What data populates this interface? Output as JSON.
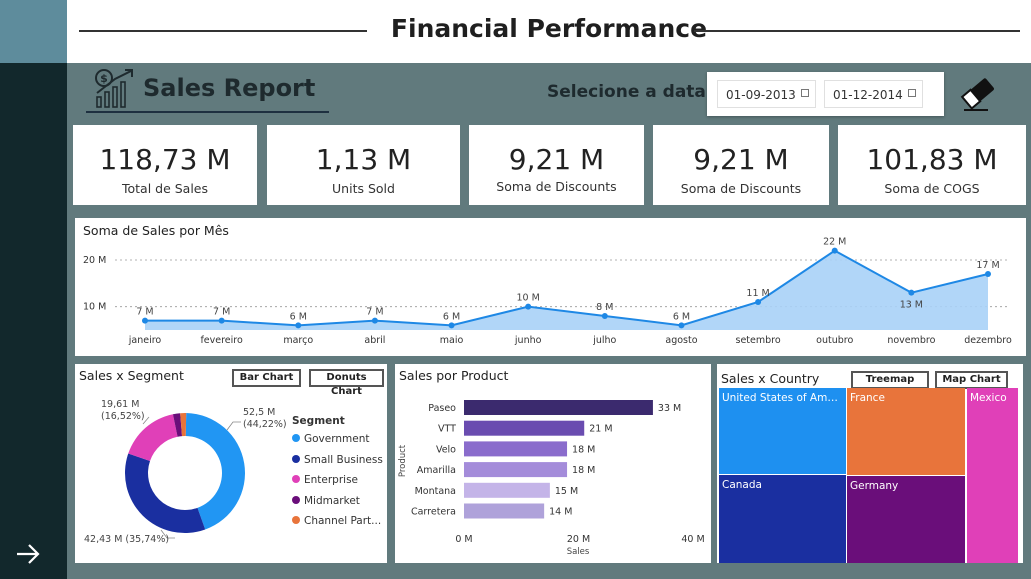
{
  "header": {
    "title": "Financial Performance"
  },
  "report": {
    "title": "Sales Report"
  },
  "date_filter": {
    "label": "Selecione a data",
    "start": "01-09-2013",
    "end": "01-12-2014"
  },
  "kpis": [
    {
      "value": "118,73 M",
      "label": "Total de  Sales"
    },
    {
      "value": "1,13 M",
      "label": "Units Sold"
    },
    {
      "value": "9,21 M",
      "label": "Soma de Discounts"
    },
    {
      "value": "9,21 M",
      "label": "Soma de Discounts"
    },
    {
      "value": "101,83 M",
      "label": "Soma de COGS"
    }
  ],
  "line_panel": {
    "title": "Soma de Sales por Mês"
  },
  "segment_panel": {
    "title": "Sales x Segment",
    "bar_button": "Bar Chart",
    "donut_button": "Donuts Chart",
    "legend_title": "Segment",
    "label_a": "52,5 M",
    "label_a2": "(44,22%)",
    "label_b": "42,43 M (35,74%)",
    "label_c": "19,61 M",
    "label_c2": "(16,52%)"
  },
  "product_panel": {
    "title": "Sales por Product"
  },
  "country_panel": {
    "title": "Sales x Country",
    "treemap_button": "Treemap Chart",
    "map_button": "Map Chart"
  },
  "colors": {
    "government": "#2196F3",
    "small_business": "#1A2FA0",
    "enterprise": "#E040B8",
    "midmarket": "#6A0E7A",
    "channel_partners": "#E8743B",
    "line": "#1E88E5",
    "area": "#A9D2F7"
  },
  "chart_data": [
    {
      "type": "area",
      "title": "Soma de Sales por Mês",
      "categories": [
        "janeiro",
        "fevereiro",
        "março",
        "abril",
        "maio",
        "junho",
        "julho",
        "agosto",
        "setembro",
        "outubro",
        "novembro",
        "dezembro"
      ],
      "values": [
        7,
        7,
        6,
        7,
        6,
        10,
        8,
        6,
        11,
        22,
        13,
        17
      ],
      "data_labels": [
        "7 M",
        "7 M",
        "6 M",
        "7 M",
        "6 M",
        "10 M",
        "8 M",
        "6 M",
        "11 M",
        "22 M",
        "13 M",
        "17 M"
      ],
      "y_ticks": [
        "10 M",
        "20 M"
      ],
      "y_tick_values": [
        10,
        20
      ],
      "ylim": [
        5,
        23
      ],
      "grid": true
    },
    {
      "type": "pie",
      "title": "Sales x Segment",
      "categories": [
        "Government",
        "Small Business",
        "Enterprise",
        "Midmarket",
        "Channel Part..."
      ],
      "values": [
        52.5,
        42.43,
        19.61,
        2.3,
        1.9
      ]
    },
    {
      "type": "bar",
      "title": "Sales por Product",
      "categories": [
        "Paseo",
        "VTT",
        "Velo",
        "Amarilla",
        "Montana",
        "Carretera"
      ],
      "values": [
        33,
        21,
        18,
        18,
        15,
        14
      ],
      "data_labels": [
        "33 M",
        "21 M",
        "18 M",
        "18 M",
        "15 M",
        "14 M"
      ],
      "bar_colors": [
        "#3B2A6E",
        "#6A4CB0",
        "#8A6CCC",
        "#A48CDA",
        "#C4B4E8",
        "#AFA2DA"
      ],
      "x_ticks": [
        "0 M",
        "20 M",
        "40 M"
      ],
      "x_tick_values": [
        0,
        20,
        40
      ],
      "xlim": [
        0,
        40
      ],
      "xlabel": "Sales",
      "ylabel": "Product"
    },
    {
      "type": "heatmap",
      "title": "Sales x Country",
      "categories": [
        "United States of Ameri...",
        "France",
        "Mexico",
        "Canada",
        "Germany"
      ],
      "tile_colors": [
        "#1E90F0",
        "#E8743B",
        "#E040B8",
        "#1A2FA0",
        "#6A0E7A"
      ]
    }
  ]
}
